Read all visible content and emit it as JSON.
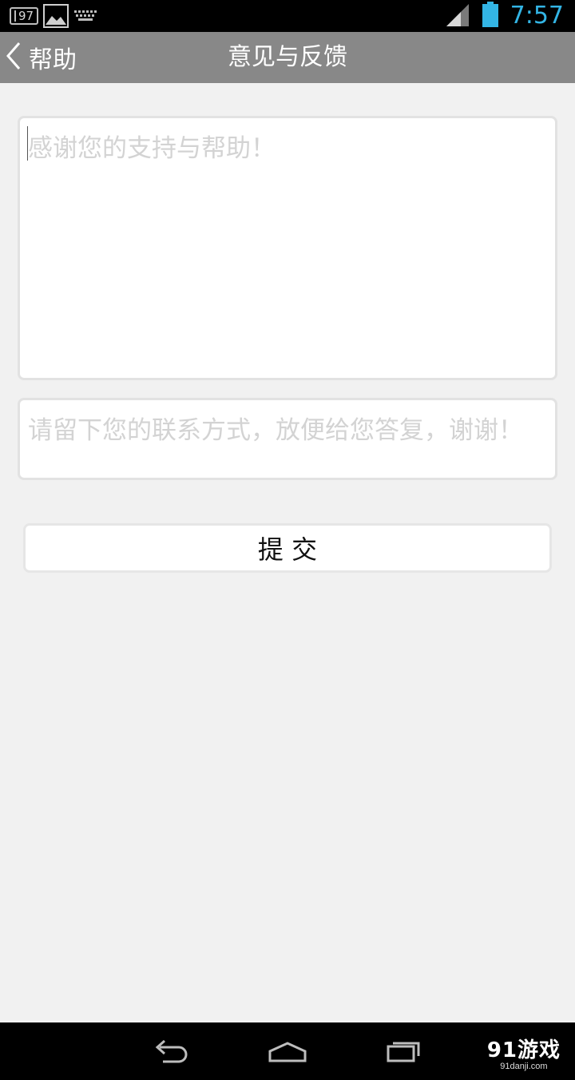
{
  "status_bar": {
    "notification_count": "97",
    "notification_icons": [
      "gallery-icon",
      "keyboard-icon"
    ],
    "status_icons": [
      "signal-icon",
      "battery-icon"
    ],
    "time": "7:57",
    "time_color": "#33b5e5"
  },
  "action_bar": {
    "back_label": "帮助",
    "title": "意见与反馈",
    "background": "#888888"
  },
  "form": {
    "feedback_placeholder": "感谢您的支持与帮助！",
    "contact_placeholder": "请留下您的联系方式，放便给您答复，谢谢！",
    "submit_label": "提 交"
  },
  "nav_bar": {
    "buttons": [
      "back-nav-icon",
      "home-nav-icon",
      "recents-nav-icon"
    ],
    "watermark_main": "91游戏",
    "watermark_sub": "91danji.com"
  }
}
